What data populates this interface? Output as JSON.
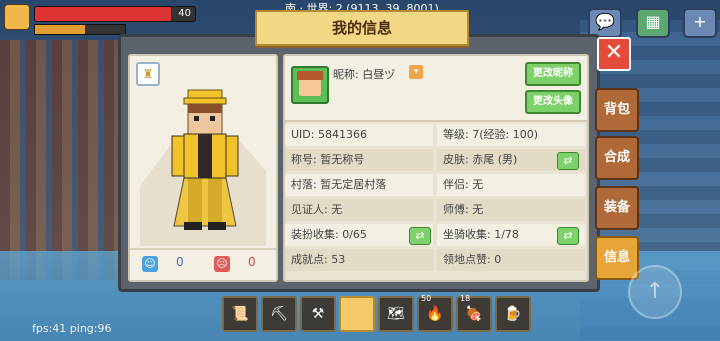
{
  "hud": {
    "hp_value": "40",
    "hp_fraction": 0.85,
    "hunger_fraction": 0.55,
    "coords_text": "南 · 世界: 2 (9113, 39, 8001)",
    "fps_text": "fps:41 ping:96"
  },
  "dialog": {
    "title": "我的信息",
    "close_label": "✕"
  },
  "side_tabs": [
    {
      "label": "背包"
    },
    {
      "label": "合成"
    },
    {
      "label": "装备"
    },
    {
      "label": "信息"
    }
  ],
  "character": {
    "likes_blue": "0",
    "likes_red": "0"
  },
  "profile": {
    "nickname_label": "昵称: 白昼ヅ",
    "change_nick_btn": "更改昵称",
    "change_avatar_btn": "更改头像"
  },
  "info": {
    "uid": "UID: 5841366",
    "level": "等级: 7(经验: 100)",
    "title": "称号: 暂无称号",
    "skin": "皮肤: 赤尾 (男)",
    "village": "村落: 暂无定居村落",
    "partner": "伴侣: 无",
    "witness": "见证人: 无",
    "master": "师傅: 无",
    "outfit": "装扮收集: 0/65",
    "mount": "坐骑收集: 1/78",
    "achievement": "成就点: 53",
    "territory": "领地点赞: 0"
  },
  "hotbar": [
    {
      "icon": "scroll-icon",
      "glyph": "📜",
      "count": ""
    },
    {
      "icon": "pickaxe-icon",
      "glyph": "⛏",
      "count": ""
    },
    {
      "icon": "shovel-icon",
      "glyph": "⚒",
      "count": ""
    },
    {
      "icon": "empty-slot",
      "glyph": "",
      "count": ""
    },
    {
      "icon": "map-icon",
      "glyph": "🗺",
      "count": ""
    },
    {
      "icon": "torch-icon",
      "glyph": "🔥",
      "count": "50"
    },
    {
      "icon": "meat-icon",
      "glyph": "🍖",
      "count": "18"
    },
    {
      "icon": "drink-icon",
      "glyph": "🍺",
      "count": ""
    }
  ]
}
